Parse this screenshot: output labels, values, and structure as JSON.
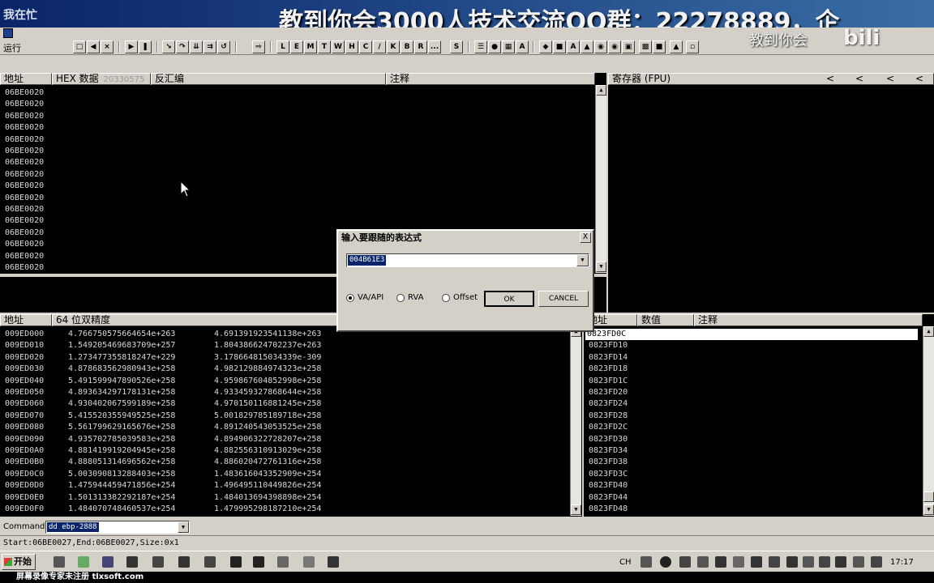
{
  "window": {
    "title_fragment": "我在忙",
    "watermark": "教到你会3000人技术交流QQ群：22278889，企",
    "brand": "教到你会",
    "logo": "bilibili"
  },
  "toolbar": {
    "state_label": "运行",
    "letter_buttons": [
      "L",
      "E",
      "M",
      "T",
      "W",
      "H",
      "C",
      "/",
      "K",
      "B",
      "R",
      "...",
      "S"
    ]
  },
  "disasm": {
    "headers": {
      "address": "地址",
      "hex": "HEX 数据",
      "disasm": "反汇编",
      "comment": "注释"
    },
    "overlay_num": "20330575",
    "rows": [
      "06BE0020",
      "06BE0020",
      "06BE0020",
      "06BE0020",
      "06BE0020",
      "06BE0020",
      "06BE0020",
      "06BE0020",
      "06BE0020",
      "06BE0020",
      "06BE0020",
      "06BE0020",
      "06BE0020",
      "06BE0020",
      "06BE0020",
      "06BE0020"
    ]
  },
  "registers": {
    "header": "寄存器 (FPU)",
    "arrows": [
      "<",
      "<",
      "<",
      "<"
    ]
  },
  "dump": {
    "headers": {
      "address": "地址",
      "format": "64 位双精度"
    },
    "rows": [
      {
        "addr": "009ED000",
        "v1": "4.766750575664654e+263",
        "v2": "4.691391923541138e+263"
      },
      {
        "addr": "009ED010",
        "v1": "1.549205469683709e+257",
        "v2": "1.804386624702237e+263"
      },
      {
        "addr": "009ED020",
        "v1": "1.273477355818247e+229",
        "v2": "3.178664815034339e-309"
      },
      {
        "addr": "009ED030",
        "v1": "4.878683562980943e+258",
        "v2": "4.982129884974323e+258"
      },
      {
        "addr": "009ED040",
        "v1": "5.491599947890526e+258",
        "v2": "4.959867604852998e+258"
      },
      {
        "addr": "009ED050",
        "v1": "4.893634297178131e+258",
        "v2": "4.933459327868644e+258"
      },
      {
        "addr": "009ED060",
        "v1": "4.930402067599189e+258",
        "v2": "4.970150116881245e+258"
      },
      {
        "addr": "009ED070",
        "v1": "5.415520355949525e+258",
        "v2": "5.001829785189718e+258"
      },
      {
        "addr": "009ED080",
        "v1": "5.561799629165676e+258",
        "v2": "4.891240543053525e+258"
      },
      {
        "addr": "009ED090",
        "v1": "4.935702785039583e+258",
        "v2": "4.894906322728207e+258"
      },
      {
        "addr": "009ED0A0",
        "v1": "4.881419919204945e+258",
        "v2": "4.882556310913029e+258"
      },
      {
        "addr": "009ED0B0",
        "v1": "4.888051314696562e+258",
        "v2": "4.886020472761316e+258"
      },
      {
        "addr": "009ED0C0",
        "v1": "5.003090813288403e+258",
        "v2": "1.483616043352909e+254"
      },
      {
        "addr": "009ED0D0",
        "v1": "1.475944459471856e+254",
        "v2": "1.496495110449826e+254"
      },
      {
        "addr": "009ED0E0",
        "v1": "1.501313382292187e+254",
        "v2": "1.484013694398898e+254"
      },
      {
        "addr": "009ED0F0",
        "v1": "1.484070748460537e+254",
        "v2": "1.479995298187210e+254"
      }
    ]
  },
  "stack": {
    "headers": {
      "address": "地址",
      "value": "数值",
      "comment": "注释"
    },
    "rows": [
      "0823FD0C",
      "0823FD10",
      "0823FD14",
      "0823FD18",
      "0823FD1C",
      "0823FD20",
      "0823FD24",
      "0823FD28",
      "0823FD2C",
      "0823FD30",
      "0823FD34",
      "0823FD38",
      "0823FD3C",
      "0823FD40",
      "0823FD44",
      "0823FD48"
    ]
  },
  "dialog": {
    "title": "输入要跟随的表达式",
    "close": "X",
    "expression": "004B61E3",
    "radios": [
      {
        "label": "VA/API",
        "selected": true
      },
      {
        "label": "RVA",
        "selected": false
      },
      {
        "label": "Offset",
        "selected": false
      }
    ],
    "ok": "OK",
    "cancel": "CANCEL"
  },
  "command": {
    "label": "Command :",
    "value": "dd ebp-2888"
  },
  "status": {
    "text": "Start:06BE0027,End:06BE0027,Size:0x1"
  },
  "taskbar": {
    "start": "开始",
    "lang": "CH",
    "clock": "17:17"
  },
  "bottom_strip": {
    "text": "屏幕录像专家未注册 tlxsoft.com"
  },
  "colors": {
    "pane_bg": "#000000",
    "pane_text": "#d8d8d8",
    "chrome": "#d4d0c8",
    "selection": "#0a246a"
  }
}
